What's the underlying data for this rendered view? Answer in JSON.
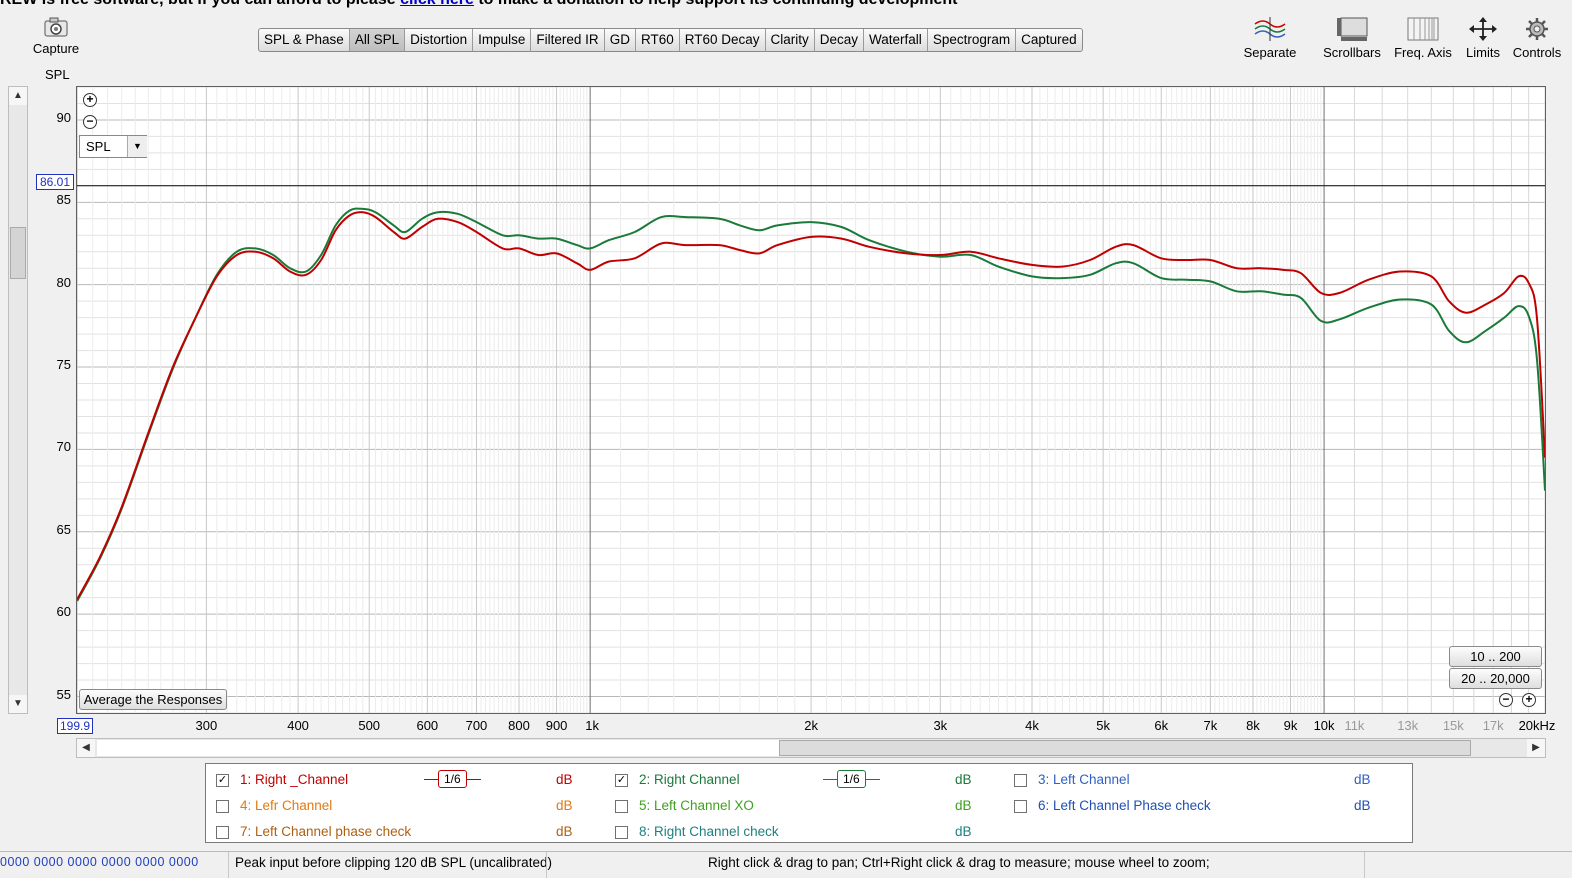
{
  "banner": {
    "text_before": "REW is free software, but if you can afford to please ",
    "link": "click here",
    "text_after": " to make a donation to help support its continuing development"
  },
  "toolbar": {
    "capture_label": "Capture",
    "spl_label": "SPL",
    "tabs": [
      "SPL & Phase",
      "All SPL",
      "Distortion",
      "Impulse",
      "Filtered IR",
      "GD",
      "RT60",
      "RT60 Decay",
      "Clarity",
      "Decay",
      "Waterfall",
      "Spectrogram",
      "Captured"
    ],
    "active_tab": "All SPL",
    "right_buttons": [
      "Separate",
      "Scrollbars",
      "Freq. Axis",
      "Limits",
      "Controls"
    ]
  },
  "graph": {
    "y_ticks": [
      "90",
      "85",
      "80",
      "75",
      "70",
      "65",
      "60",
      "55"
    ],
    "cursor_value": "86.01",
    "x_start": "199.9",
    "x_ticks": [
      "300",
      "400",
      "500",
      "600",
      "700",
      "800",
      "900",
      "1k",
      "2k",
      "3k",
      "4k",
      "5k",
      "6k",
      "7k",
      "8k",
      "9k",
      "10k",
      "11k",
      "13k",
      "15k",
      "17k",
      "20kHz"
    ],
    "spl_selector": "SPL",
    "avg_button": "Average the Responses",
    "range_buttons": [
      "10 .. 200",
      "20 .. 20,000"
    ]
  },
  "chart_data": {
    "type": "line",
    "xlabel": "",
    "ylabel": "SPL",
    "xscale": "log",
    "xlim": [
      199.9,
      20000
    ],
    "ylim": [
      54,
      92
    ],
    "cursor_y": 86.01,
    "series": [
      {
        "name": "1: Right _Channel",
        "color": "#c00000",
        "points": [
          [
            200,
            60.9
          ],
          [
            215,
            63.5
          ],
          [
            230,
            66.5
          ],
          [
            250,
            71.0
          ],
          [
            270,
            75.0
          ],
          [
            290,
            78.0
          ],
          [
            310,
            80.5
          ],
          [
            330,
            81.8
          ],
          [
            350,
            82.0
          ],
          [
            370,
            81.6
          ],
          [
            390,
            80.8
          ],
          [
            410,
            80.6
          ],
          [
            430,
            81.5
          ],
          [
            450,
            83.3
          ],
          [
            470,
            84.2
          ],
          [
            490,
            84.4
          ],
          [
            510,
            84.1
          ],
          [
            540,
            83.2
          ],
          [
            560,
            82.8
          ],
          [
            590,
            83.5
          ],
          [
            620,
            84.0
          ],
          [
            660,
            83.8
          ],
          [
            700,
            83.2
          ],
          [
            760,
            82.2
          ],
          [
            800,
            82.2
          ],
          [
            850,
            81.8
          ],
          [
            900,
            81.9
          ],
          [
            960,
            81.3
          ],
          [
            1000,
            80.9
          ],
          [
            1060,
            81.4
          ],
          [
            1150,
            81.6
          ],
          [
            1250,
            82.5
          ],
          [
            1350,
            82.4
          ],
          [
            1500,
            82.4
          ],
          [
            1600,
            82.1
          ],
          [
            1700,
            81.9
          ],
          [
            1800,
            82.4
          ],
          [
            2000,
            82.9
          ],
          [
            2200,
            82.8
          ],
          [
            2400,
            82.3
          ],
          [
            2700,
            81.9
          ],
          [
            3000,
            81.8
          ],
          [
            3300,
            82.0
          ],
          [
            3600,
            81.6
          ],
          [
            4000,
            81.2
          ],
          [
            4400,
            81.1
          ],
          [
            4800,
            81.5
          ],
          [
            5200,
            82.3
          ],
          [
            5500,
            82.4
          ],
          [
            6000,
            81.6
          ],
          [
            6500,
            81.5
          ],
          [
            7000,
            81.5
          ],
          [
            7600,
            81.0
          ],
          [
            8200,
            81.0
          ],
          [
            8800,
            80.9
          ],
          [
            9300,
            80.7
          ],
          [
            9900,
            79.5
          ],
          [
            10500,
            79.5
          ],
          [
            11500,
            80.3
          ],
          [
            12700,
            80.8
          ],
          [
            14000,
            80.5
          ],
          [
            14800,
            79.0
          ],
          [
            15600,
            78.3
          ],
          [
            16600,
            78.8
          ],
          [
            17600,
            79.5
          ],
          [
            18400,
            80.5
          ],
          [
            19000,
            80.1
          ],
          [
            19500,
            78.0
          ],
          [
            20000,
            69.5
          ]
        ]
      },
      {
        "name": "2: Right Channel",
        "color": "#1a7a3a",
        "points": [
          [
            200,
            60.8
          ],
          [
            215,
            63.4
          ],
          [
            230,
            66.4
          ],
          [
            250,
            70.9
          ],
          [
            270,
            74.9
          ],
          [
            290,
            78.0
          ],
          [
            310,
            80.6
          ],
          [
            330,
            82.0
          ],
          [
            350,
            82.2
          ],
          [
            370,
            81.8
          ],
          [
            390,
            81.0
          ],
          [
            410,
            80.8
          ],
          [
            430,
            81.8
          ],
          [
            450,
            83.6
          ],
          [
            470,
            84.5
          ],
          [
            490,
            84.6
          ],
          [
            510,
            84.4
          ],
          [
            540,
            83.6
          ],
          [
            560,
            83.2
          ],
          [
            590,
            84.0
          ],
          [
            620,
            84.4
          ],
          [
            660,
            84.3
          ],
          [
            700,
            83.8
          ],
          [
            760,
            83.0
          ],
          [
            800,
            83.0
          ],
          [
            850,
            82.8
          ],
          [
            900,
            82.8
          ],
          [
            960,
            82.4
          ],
          [
            1000,
            82.2
          ],
          [
            1060,
            82.7
          ],
          [
            1150,
            83.2
          ],
          [
            1250,
            84.1
          ],
          [
            1350,
            84.1
          ],
          [
            1500,
            84.0
          ],
          [
            1600,
            83.6
          ],
          [
            1700,
            83.3
          ],
          [
            1800,
            83.6
          ],
          [
            2000,
            83.8
          ],
          [
            2200,
            83.5
          ],
          [
            2400,
            82.7
          ],
          [
            2700,
            82.0
          ],
          [
            3000,
            81.7
          ],
          [
            3300,
            81.8
          ],
          [
            3600,
            81.1
          ],
          [
            4000,
            80.5
          ],
          [
            4400,
            80.4
          ],
          [
            4800,
            80.6
          ],
          [
            5200,
            81.3
          ],
          [
            5500,
            81.3
          ],
          [
            6000,
            80.4
          ],
          [
            6500,
            80.3
          ],
          [
            7000,
            80.2
          ],
          [
            7600,
            79.6
          ],
          [
            8200,
            79.6
          ],
          [
            8800,
            79.4
          ],
          [
            9300,
            79.2
          ],
          [
            9900,
            77.8
          ],
          [
            10500,
            77.9
          ],
          [
            11500,
            78.6
          ],
          [
            12700,
            79.1
          ],
          [
            14000,
            78.8
          ],
          [
            14800,
            77.2
          ],
          [
            15600,
            76.5
          ],
          [
            16600,
            77.2
          ],
          [
            17600,
            78.0
          ],
          [
            18400,
            78.7
          ],
          [
            19000,
            78.1
          ],
          [
            19500,
            75.5
          ],
          [
            20000,
            67.5
          ]
        ]
      }
    ]
  },
  "legend": {
    "items": [
      {
        "label": "1: Right _Channel",
        "checked": "✓",
        "unit": "dB",
        "color": "#c00000",
        "smoothing": "1/6"
      },
      {
        "label": "2: Right Channel",
        "checked": "✓",
        "unit": "dB",
        "color": "#1a7a3a",
        "smoothing": "1/6"
      },
      {
        "label": "3: Left Channel",
        "checked": "",
        "unit": "dB",
        "color": "#3060c0"
      },
      {
        "label": "4: Lefr Channel",
        "checked": "",
        "unit": "dB",
        "color": "#e07a10"
      },
      {
        "label": "5: Left Channel XO",
        "checked": "",
        "unit": "dB",
        "color": "#40a020"
      },
      {
        "label": "6: Left Channel Phase check",
        "checked": "",
        "unit": "dB",
        "color": "#2050b0"
      },
      {
        "label": "7: Left Channel phase check",
        "checked": "",
        "unit": "dB",
        "color": "#b06010"
      },
      {
        "label": "8: Right Channel check",
        "checked": "",
        "unit": "dB",
        "color": "#208080"
      }
    ]
  },
  "status": {
    "meters": "0000 0000  0000 0000  0000 0000",
    "peak": "Peak input before clipping 120 dB SPL (uncalibrated)",
    "hint": "Right click & drag to pan; Ctrl+Right click & drag to measure; mouse wheel to zoom;"
  }
}
